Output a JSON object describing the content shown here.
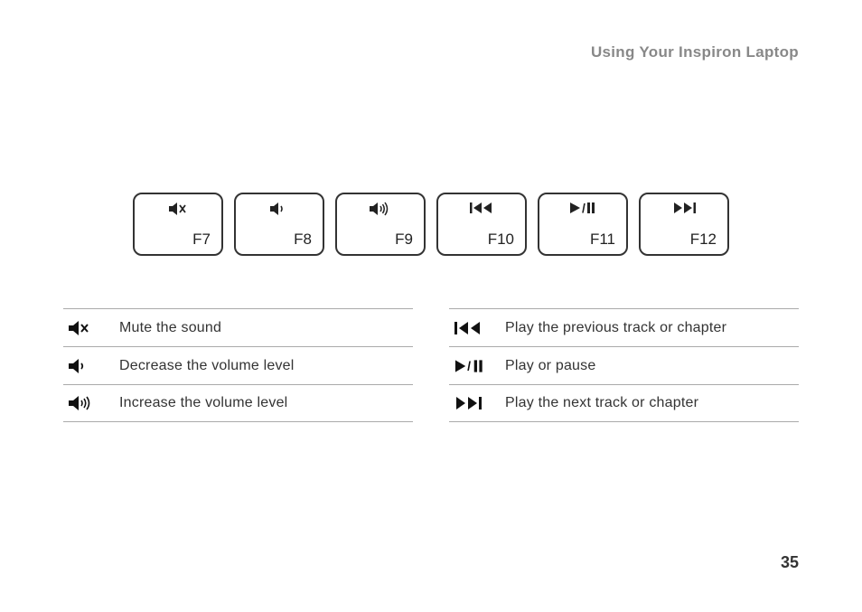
{
  "header": {
    "title": "Using Your Inspiron Laptop"
  },
  "keys": [
    {
      "icon": "mute-icon",
      "label": "F7"
    },
    {
      "icon": "volume-down-icon",
      "label": "F8"
    },
    {
      "icon": "volume-up-icon",
      "label": "F9"
    },
    {
      "icon": "prev-track-icon",
      "label": "F10"
    },
    {
      "icon": "play-pause-icon",
      "label": "F11"
    },
    {
      "icon": "next-track-icon",
      "label": "F12"
    }
  ],
  "legend_left": [
    {
      "icon": "mute-icon",
      "text": "Mute the sound"
    },
    {
      "icon": "volume-down-icon",
      "text": "Decrease the volume level"
    },
    {
      "icon": "volume-up-icon",
      "text": "Increase the volume level"
    }
  ],
  "legend_right": [
    {
      "icon": "prev-track-icon",
      "text": "Play the previous track or chapter"
    },
    {
      "icon": "play-pause-icon",
      "text": "Play or pause"
    },
    {
      "icon": "next-track-icon",
      "text": "Play the next track or chapter"
    }
  ],
  "page_number": "35"
}
